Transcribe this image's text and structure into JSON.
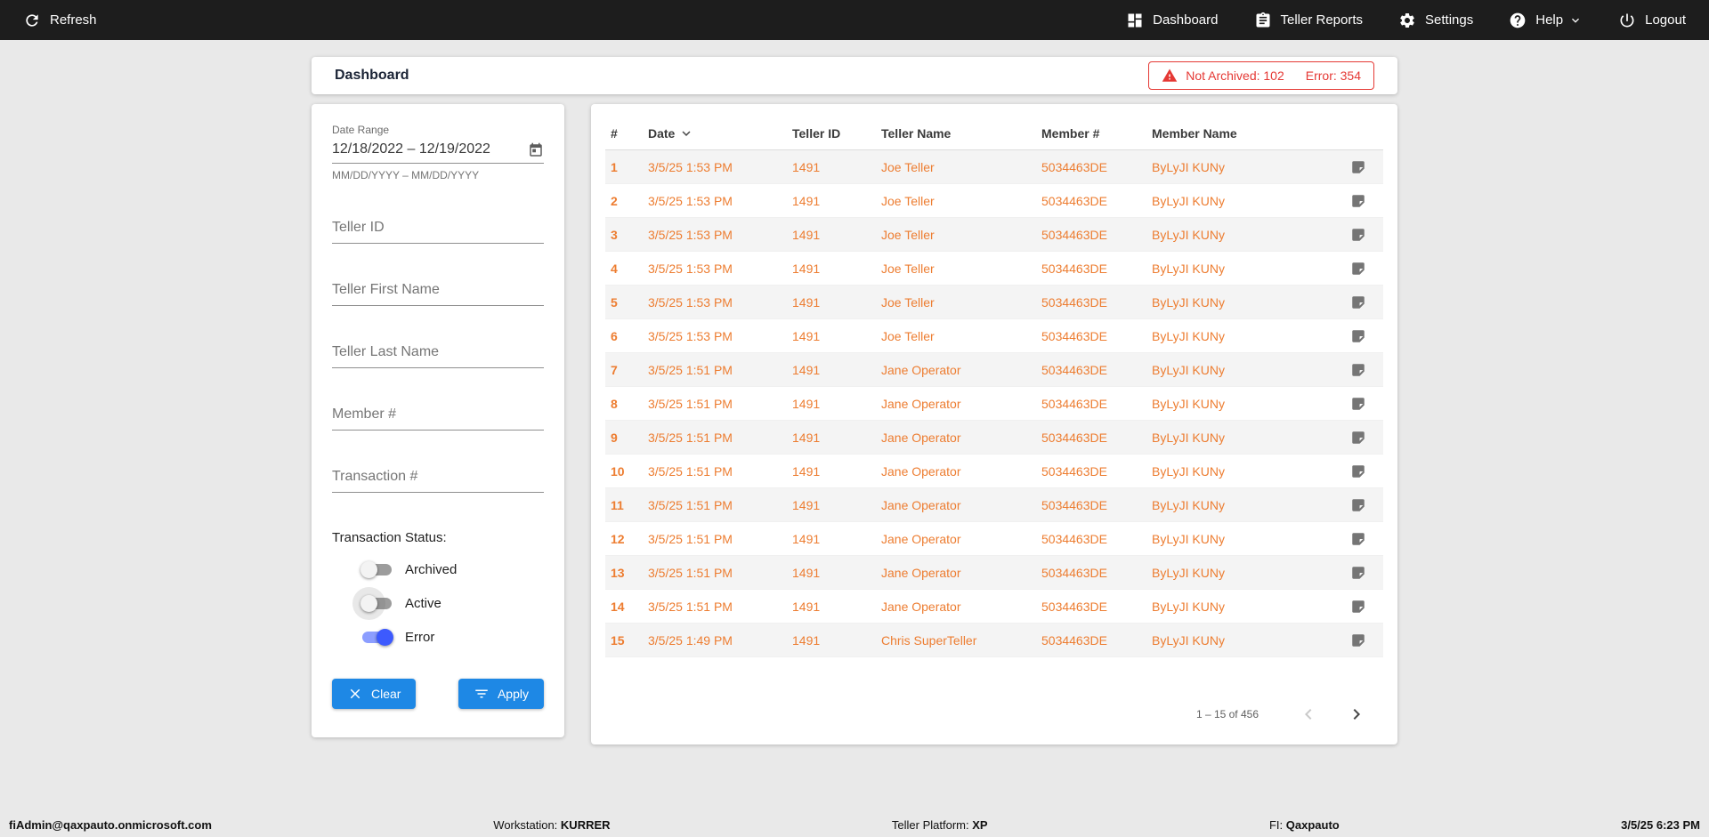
{
  "colors": {
    "accent_orange": "#ED7D31",
    "alert_red": "#E53935",
    "button_blue": "#1E88E5",
    "toggle_on_blue": "#3D5AFE",
    "topbar_bg": "#1D1D1D"
  },
  "topbar": {
    "refresh_label": "Refresh",
    "nav": [
      {
        "label": "Dashboard",
        "icon": "dashboard-icon"
      },
      {
        "label": "Teller Reports",
        "icon": "clipboard-icon"
      },
      {
        "label": "Settings",
        "icon": "gear-icon"
      },
      {
        "label": "Help",
        "icon": "help-icon"
      },
      {
        "label": "Logout",
        "icon": "power-icon"
      }
    ]
  },
  "header": {
    "title": "Dashboard",
    "alert": {
      "not_archived": "Not Archived: 102",
      "error": "Error: 354"
    }
  },
  "filters": {
    "date_range": {
      "label": "Date Range",
      "value": "12/18/2022 – 12/19/2022",
      "hint": "MM/DD/YYYY – MM/DD/YYYY"
    },
    "inputs": [
      {
        "placeholder": "Teller ID"
      },
      {
        "placeholder": "Teller First Name"
      },
      {
        "placeholder": "Teller Last Name"
      },
      {
        "placeholder": "Member #"
      },
      {
        "placeholder": "Transaction #"
      }
    ],
    "status": {
      "label": "Transaction Status:",
      "toggles": [
        {
          "label": "Archived",
          "on": false,
          "focused": false
        },
        {
          "label": "Active",
          "on": false,
          "focused": true
        },
        {
          "label": "Error",
          "on": true,
          "focused": false
        }
      ]
    },
    "clear_label": "Clear",
    "apply_label": "Apply"
  },
  "table": {
    "columns": [
      "#",
      "Date",
      "Teller ID",
      "Teller Name",
      "Member #",
      "Member Name"
    ],
    "rows": [
      {
        "num": "1",
        "date": "3/5/25 1:53 PM",
        "teller_id": "1491",
        "teller_name": "Joe Teller",
        "member_num": "5034463DE",
        "member_name": "ByLyJI KUNy"
      },
      {
        "num": "2",
        "date": "3/5/25 1:53 PM",
        "teller_id": "1491",
        "teller_name": "Joe Teller",
        "member_num": "5034463DE",
        "member_name": "ByLyJI KUNy"
      },
      {
        "num": "3",
        "date": "3/5/25 1:53 PM",
        "teller_id": "1491",
        "teller_name": "Joe Teller",
        "member_num": "5034463DE",
        "member_name": "ByLyJI KUNy"
      },
      {
        "num": "4",
        "date": "3/5/25 1:53 PM",
        "teller_id": "1491",
        "teller_name": "Joe Teller",
        "member_num": "5034463DE",
        "member_name": "ByLyJI KUNy"
      },
      {
        "num": "5",
        "date": "3/5/25 1:53 PM",
        "teller_id": "1491",
        "teller_name": "Joe Teller",
        "member_num": "5034463DE",
        "member_name": "ByLyJI KUNy"
      },
      {
        "num": "6",
        "date": "3/5/25 1:53 PM",
        "teller_id": "1491",
        "teller_name": "Joe Teller",
        "member_num": "5034463DE",
        "member_name": "ByLyJI KUNy"
      },
      {
        "num": "7",
        "date": "3/5/25 1:51 PM",
        "teller_id": "1491",
        "teller_name": "Jane Operator",
        "member_num": "5034463DE",
        "member_name": "ByLyJI KUNy"
      },
      {
        "num": "8",
        "date": "3/5/25 1:51 PM",
        "teller_id": "1491",
        "teller_name": "Jane Operator",
        "member_num": "5034463DE",
        "member_name": "ByLyJI KUNy"
      },
      {
        "num": "9",
        "date": "3/5/25 1:51 PM",
        "teller_id": "1491",
        "teller_name": "Jane Operator",
        "member_num": "5034463DE",
        "member_name": "ByLyJI KUNy"
      },
      {
        "num": "10",
        "date": "3/5/25 1:51 PM",
        "teller_id": "1491",
        "teller_name": "Jane Operator",
        "member_num": "5034463DE",
        "member_name": "ByLyJI KUNy"
      },
      {
        "num": "11",
        "date": "3/5/25 1:51 PM",
        "teller_id": "1491",
        "teller_name": "Jane Operator",
        "member_num": "5034463DE",
        "member_name": "ByLyJI KUNy"
      },
      {
        "num": "12",
        "date": "3/5/25 1:51 PM",
        "teller_id": "1491",
        "teller_name": "Jane Operator",
        "member_num": "5034463DE",
        "member_name": "ByLyJI KUNy"
      },
      {
        "num": "13",
        "date": "3/5/25 1:51 PM",
        "teller_id": "1491",
        "teller_name": "Jane Operator",
        "member_num": "5034463DE",
        "member_name": "ByLyJI KUNy"
      },
      {
        "num": "14",
        "date": "3/5/25 1:51 PM",
        "teller_id": "1491",
        "teller_name": "Jane Operator",
        "member_num": "5034463DE",
        "member_name": "ByLyJI KUNy"
      },
      {
        "num": "15",
        "date": "3/5/25 1:49 PM",
        "teller_id": "1491",
        "teller_name": "Chris SuperTeller",
        "member_num": "5034463DE",
        "member_name": "ByLyJI KUNy"
      }
    ],
    "pagination": {
      "range": "1 – 15 of 456"
    }
  },
  "footer": {
    "user_email": "fiAdmin@qaxpauto.onmicrosoft.com",
    "workstation_label": "Workstation:",
    "workstation_value": "KURRER",
    "platform_label": "Teller Platform:",
    "platform_value": "XP",
    "fi_label": "FI:",
    "fi_value": "Qaxpauto",
    "timestamp": "3/5/25 6:23 PM"
  }
}
